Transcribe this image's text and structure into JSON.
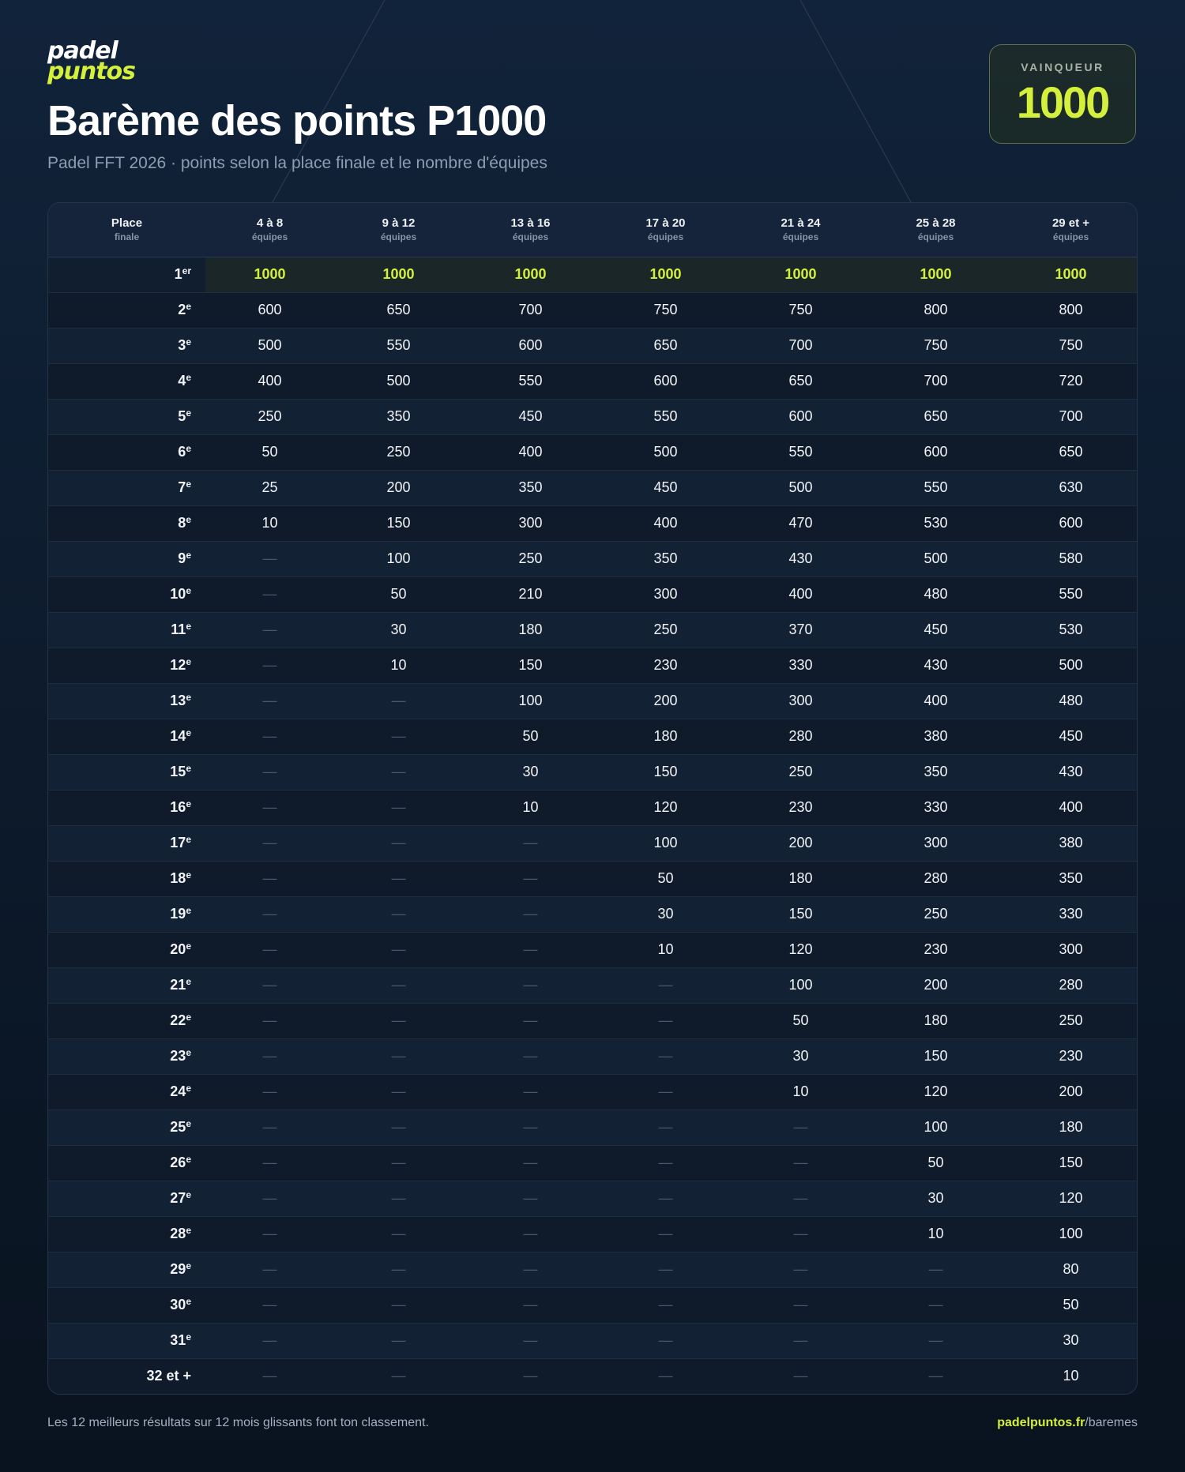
{
  "brand": {
    "logo_line1": "padel",
    "logo_line2": "puntos",
    "accent_color": "#d4f03c"
  },
  "header": {
    "title": "Barème des points P1000",
    "subtitle": "Padel FFT 2026 · points selon la place finale et le nombre d'équipes"
  },
  "winner_card": {
    "label": "VAINQUEUR",
    "value": "1000"
  },
  "table": {
    "place_header": {
      "main": "Place",
      "sub": "finale"
    },
    "columns": [
      {
        "main": "4 à 8",
        "sub": "équipes"
      },
      {
        "main": "9 à 12",
        "sub": "équipes"
      },
      {
        "main": "13 à 16",
        "sub": "équipes"
      },
      {
        "main": "17 à 20",
        "sub": "équipes"
      },
      {
        "main": "21 à 24",
        "sub": "équipes"
      },
      {
        "main": "25 à 28",
        "sub": "équipes"
      },
      {
        "main": "29 et +",
        "sub": "équipes"
      }
    ],
    "rows": [
      {
        "num": "1",
        "sup": "er",
        "values": [
          "1000",
          "1000",
          "1000",
          "1000",
          "1000",
          "1000",
          "1000"
        ]
      },
      {
        "num": "2",
        "sup": "e",
        "values": [
          "600",
          "650",
          "700",
          "750",
          "750",
          "800",
          "800"
        ]
      },
      {
        "num": "3",
        "sup": "e",
        "values": [
          "500",
          "550",
          "600",
          "650",
          "700",
          "750",
          "750"
        ]
      },
      {
        "num": "4",
        "sup": "e",
        "values": [
          "400",
          "500",
          "550",
          "600",
          "650",
          "700",
          "720"
        ]
      },
      {
        "num": "5",
        "sup": "e",
        "values": [
          "250",
          "350",
          "450",
          "550",
          "600",
          "650",
          "700"
        ]
      },
      {
        "num": "6",
        "sup": "e",
        "values": [
          "50",
          "250",
          "400",
          "500",
          "550",
          "600",
          "650"
        ]
      },
      {
        "num": "7",
        "sup": "e",
        "values": [
          "25",
          "200",
          "350",
          "450",
          "500",
          "550",
          "630"
        ]
      },
      {
        "num": "8",
        "sup": "e",
        "values": [
          "10",
          "150",
          "300",
          "400",
          "470",
          "530",
          "600"
        ]
      },
      {
        "num": "9",
        "sup": "e",
        "values": [
          "—",
          "100",
          "250",
          "350",
          "430",
          "500",
          "580"
        ]
      },
      {
        "num": "10",
        "sup": "e",
        "values": [
          "—",
          "50",
          "210",
          "300",
          "400",
          "480",
          "550"
        ]
      },
      {
        "num": "11",
        "sup": "e",
        "values": [
          "—",
          "30",
          "180",
          "250",
          "370",
          "450",
          "530"
        ]
      },
      {
        "num": "12",
        "sup": "e",
        "values": [
          "—",
          "10",
          "150",
          "230",
          "330",
          "430",
          "500"
        ]
      },
      {
        "num": "13",
        "sup": "e",
        "values": [
          "—",
          "—",
          "100",
          "200",
          "300",
          "400",
          "480"
        ]
      },
      {
        "num": "14",
        "sup": "e",
        "values": [
          "—",
          "—",
          "50",
          "180",
          "280",
          "380",
          "450"
        ]
      },
      {
        "num": "15",
        "sup": "e",
        "values": [
          "—",
          "—",
          "30",
          "150",
          "250",
          "350",
          "430"
        ]
      },
      {
        "num": "16",
        "sup": "e",
        "values": [
          "—",
          "—",
          "10",
          "120",
          "230",
          "330",
          "400"
        ]
      },
      {
        "num": "17",
        "sup": "e",
        "values": [
          "—",
          "—",
          "—",
          "100",
          "200",
          "300",
          "380"
        ]
      },
      {
        "num": "18",
        "sup": "e",
        "values": [
          "—",
          "—",
          "—",
          "50",
          "180",
          "280",
          "350"
        ]
      },
      {
        "num": "19",
        "sup": "e",
        "values": [
          "—",
          "—",
          "—",
          "30",
          "150",
          "250",
          "330"
        ]
      },
      {
        "num": "20",
        "sup": "e",
        "values": [
          "—",
          "—",
          "—",
          "10",
          "120",
          "230",
          "300"
        ]
      },
      {
        "num": "21",
        "sup": "e",
        "values": [
          "—",
          "—",
          "—",
          "—",
          "100",
          "200",
          "280"
        ]
      },
      {
        "num": "22",
        "sup": "e",
        "values": [
          "—",
          "—",
          "—",
          "—",
          "50",
          "180",
          "250"
        ]
      },
      {
        "num": "23",
        "sup": "e",
        "values": [
          "—",
          "—",
          "—",
          "—",
          "30",
          "150",
          "230"
        ]
      },
      {
        "num": "24",
        "sup": "e",
        "values": [
          "—",
          "—",
          "—",
          "—",
          "10",
          "120",
          "200"
        ]
      },
      {
        "num": "25",
        "sup": "e",
        "values": [
          "—",
          "—",
          "—",
          "—",
          "—",
          "100",
          "180"
        ]
      },
      {
        "num": "26",
        "sup": "e",
        "values": [
          "—",
          "—",
          "—",
          "—",
          "—",
          "50",
          "150"
        ]
      },
      {
        "num": "27",
        "sup": "e",
        "values": [
          "—",
          "—",
          "—",
          "—",
          "—",
          "30",
          "120"
        ]
      },
      {
        "num": "28",
        "sup": "e",
        "values": [
          "—",
          "—",
          "—",
          "—",
          "—",
          "10",
          "100"
        ]
      },
      {
        "num": "29",
        "sup": "e",
        "values": [
          "—",
          "—",
          "—",
          "—",
          "—",
          "—",
          "80"
        ]
      },
      {
        "num": "30",
        "sup": "e",
        "values": [
          "—",
          "—",
          "—",
          "—",
          "—",
          "—",
          "50"
        ]
      },
      {
        "num": "31",
        "sup": "e",
        "values": [
          "—",
          "—",
          "—",
          "—",
          "—",
          "—",
          "30"
        ]
      },
      {
        "num": "32 et +",
        "sup": "",
        "values": [
          "—",
          "—",
          "—",
          "—",
          "—",
          "—",
          "10"
        ]
      }
    ]
  },
  "footer": {
    "note": "Les 12 meilleurs résultats sur 12 mois glissants font ton classement.",
    "link_domain": "padelpuntos.fr",
    "link_path": "/baremes"
  }
}
